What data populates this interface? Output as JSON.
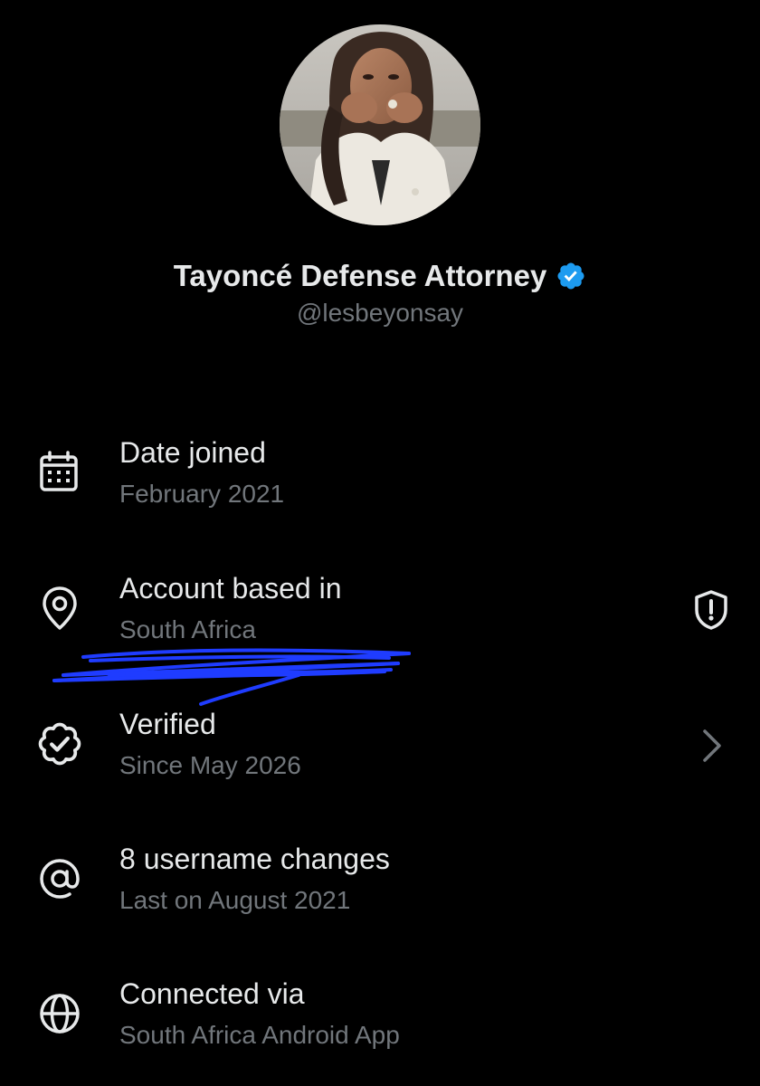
{
  "profile": {
    "display_name": "Tayoncé Defense Attorney",
    "handle": "@lesbeyonsay",
    "verified_badge_icon": "verified-check-icon",
    "badge_color": "#1d9bf0"
  },
  "about": {
    "items": [
      {
        "label": "Date joined",
        "value": "February 2021",
        "icon": "calendar-icon"
      },
      {
        "label": "Account based in",
        "value": "South Africa",
        "icon": "location-pin-icon",
        "trailing_icon": "shield-alert-icon"
      },
      {
        "label": "Verified",
        "value": "Since May 2026",
        "icon": "verified-seal-icon",
        "trailing_icon": "chevron-right-icon"
      },
      {
        "label": "8 username changes",
        "value": "Last on August 2021",
        "icon": "at-sign-icon"
      },
      {
        "label": "Connected via",
        "value": "South Africa Android App",
        "icon": "globe-icon"
      }
    ]
  },
  "colors": {
    "background": "#000000",
    "primary_text": "#e7e9ea",
    "secondary_text": "#71767b",
    "scribble": "#1f3cff"
  }
}
